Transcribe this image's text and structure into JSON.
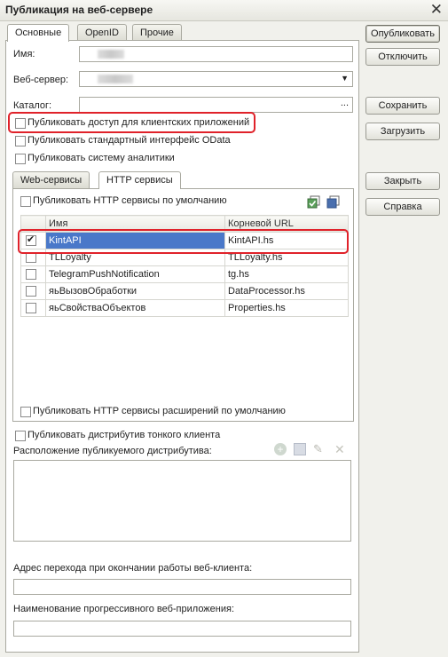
{
  "window": {
    "title": "Публикация на веб-сервере"
  },
  "tabs": [
    "Основные",
    "OpenID",
    "Прочие"
  ],
  "fields": {
    "name_label": "Имя:",
    "web_server_label": "Веб-сервер:",
    "catalog_label": "Каталог:",
    "catalog_button": "..."
  },
  "checkboxes": {
    "client_access": "Публиковать доступ для клиентских приложений",
    "odata": "Публиковать стандартный интерфейс OData",
    "analytics": "Публиковать систему аналитики"
  },
  "subtabs": [
    "Web-сервисы",
    "HTTP сервисы"
  ],
  "http": {
    "default_label": "Публиковать HTTP сервисы по умолчанию",
    "columns": [
      "Имя",
      "Корневой URL"
    ],
    "rows": [
      {
        "name": "KintAPI",
        "url": "KintAPI.hs",
        "checked": true
      },
      {
        "name": "TLLoyalty",
        "url": "TLLoyalty.hs",
        "checked": false
      },
      {
        "name": "TelegramPushNotification",
        "url": "tg.hs",
        "checked": false
      },
      {
        "name": "яьВызовОбработки",
        "url": "DataProcessor.hs",
        "checked": false
      },
      {
        "name": "яьСвойстваОбъектов",
        "url": "Properties.hs",
        "checked": false
      }
    ],
    "extensions_label": "Публиковать HTTP сервисы расширений по умолчанию"
  },
  "thin_client": {
    "publish_label": "Публиковать дистрибутив тонкого клиента",
    "location_label": "Расположение публикуемого дистрибутива:"
  },
  "bottom": {
    "exit_url_label": "Адрес перехода при окончании работы веб-клиента:",
    "pwa_label": "Наименование прогрессивного веб-приложения:"
  },
  "buttons": {
    "publish": "Опубликовать",
    "disable": "Отключить",
    "save": "Сохранить",
    "load": "Загрузить",
    "close": "Закрыть",
    "help": "Справка"
  },
  "colors": {
    "highlight": "#e0222a",
    "selection": "#4a78c9"
  }
}
